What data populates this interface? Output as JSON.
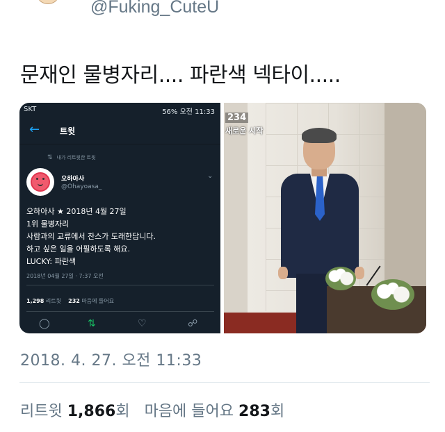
{
  "tweet": {
    "handle": "@Fuking_CuteU",
    "text": "문재인 물병자리.... 파란색 넥타이.....",
    "timestamp": "2018. 4. 27. 오전 11:33",
    "retweet_label": "리트윗",
    "retweet_count": "1,866",
    "retweet_unit": "회",
    "like_label": "마음에 들어요",
    "like_count": "283",
    "like_unit": "회"
  },
  "screenshot": {
    "status_carrier": "SKT",
    "status_right": "56% 오전 11:33",
    "app_title": "트윗",
    "retweet_note": "내가 리트윗한 트윗",
    "account_name": "오하아사",
    "account_handle": "@Ohayoasa_",
    "body_lines": [
      "오하아사 ★ 2018년 4월 27일",
      "1위 물병자리",
      "사람과의 교류에서 찬스가 도래한답니다.",
      "하고 싶은 일을 어필하도록 해요.",
      "LUCKY: 파란색"
    ],
    "date": "2018년 04월 27일 · 7:37 오전",
    "retweets_num": "1,298",
    "retweets_label": "리트윗",
    "likes_num": "232",
    "likes_label": "마음에 들어요"
  },
  "photo": {
    "overlay_number": "234",
    "overlay_caption": "새로운 시작"
  },
  "colors": {
    "accent": "#1da1f2",
    "dark_bg": "#15202b",
    "muted": "#657786",
    "tie_blue": "#2b62c9"
  }
}
